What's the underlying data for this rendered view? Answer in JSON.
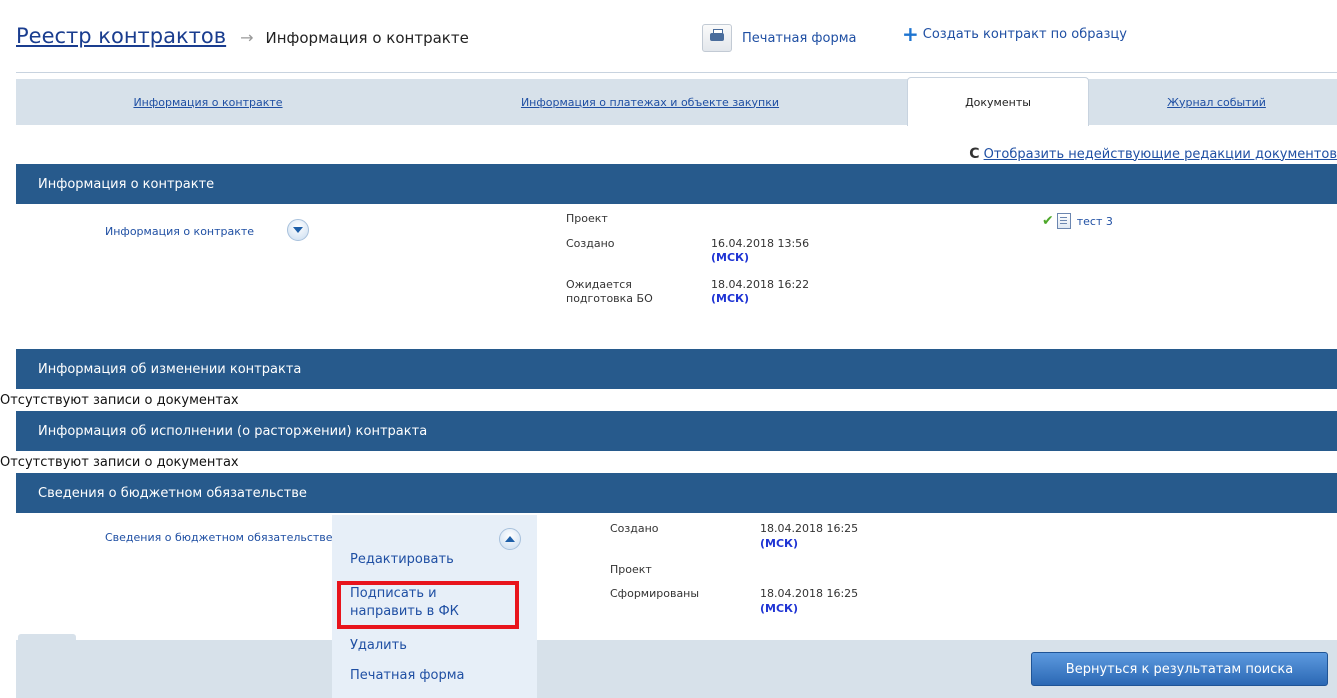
{
  "breadcrumb": {
    "root": "Реестр контрактов",
    "separator": "→",
    "current": "Информация о контракте"
  },
  "header_actions": {
    "print_form": "Печатная форма",
    "create_from_template": "Создать контракт по образцу",
    "plus_symbol": "+"
  },
  "tabs": [
    {
      "label": "Информация о контракте",
      "active": false
    },
    {
      "label": "Информация о платежах и объекте закупки",
      "active": false
    },
    {
      "label": "Документы",
      "active": true
    },
    {
      "label": "Журнал событий",
      "active": false
    }
  ],
  "show_inactive": {
    "icon_glyph": "C",
    "label": "Отобразить недействующие редакции документов"
  },
  "sections": {
    "contract_info": {
      "title": "Информация о контракте",
      "row_label": "Информация о контракте",
      "status": "Проект",
      "created_label": "Создано",
      "created_date": "16.04.2018 13:56",
      "created_tz": "(МСК)",
      "pending_label": "Ожидается подготовка БО",
      "pending_date": "18.04.2018 16:22",
      "pending_tz": "(МСК)",
      "doc_name": "тест 3",
      "check_glyph": "✔"
    },
    "contract_changes": {
      "title": "Информация об изменении контракта",
      "empty": "Отсутствуют записи о документах"
    },
    "contract_execution": {
      "title": "Информация об исполнении (о расторжении) контракта",
      "empty": "Отсутствуют записи о документах"
    },
    "budget_obligation": {
      "title": "Сведения о бюджетном обязательстве",
      "row_label": "Сведения о бюджетном обязательстве",
      "created_label": "Создано",
      "created_date": "18.04.2018 16:25",
      "created_tz": "(МСК)",
      "status": "Проект",
      "formed_label": "Сформированы",
      "formed_date": "18.04.2018 16:25",
      "formed_tz": "(МСК)"
    }
  },
  "context_menu": {
    "edit": "Редактировать",
    "sign_and_send": "Подписать и направить в ФК",
    "delete": "Удалить",
    "print_form": "Печатная форма"
  },
  "footer": {
    "return_button": "Вернуться к результатам поиска"
  },
  "colors": {
    "section_bar": "#275a8c",
    "tab_strip": "#d7e1ea",
    "link": "#1f4fa3",
    "highlight": "#e8141c",
    "return_button": "#2b68b4"
  }
}
